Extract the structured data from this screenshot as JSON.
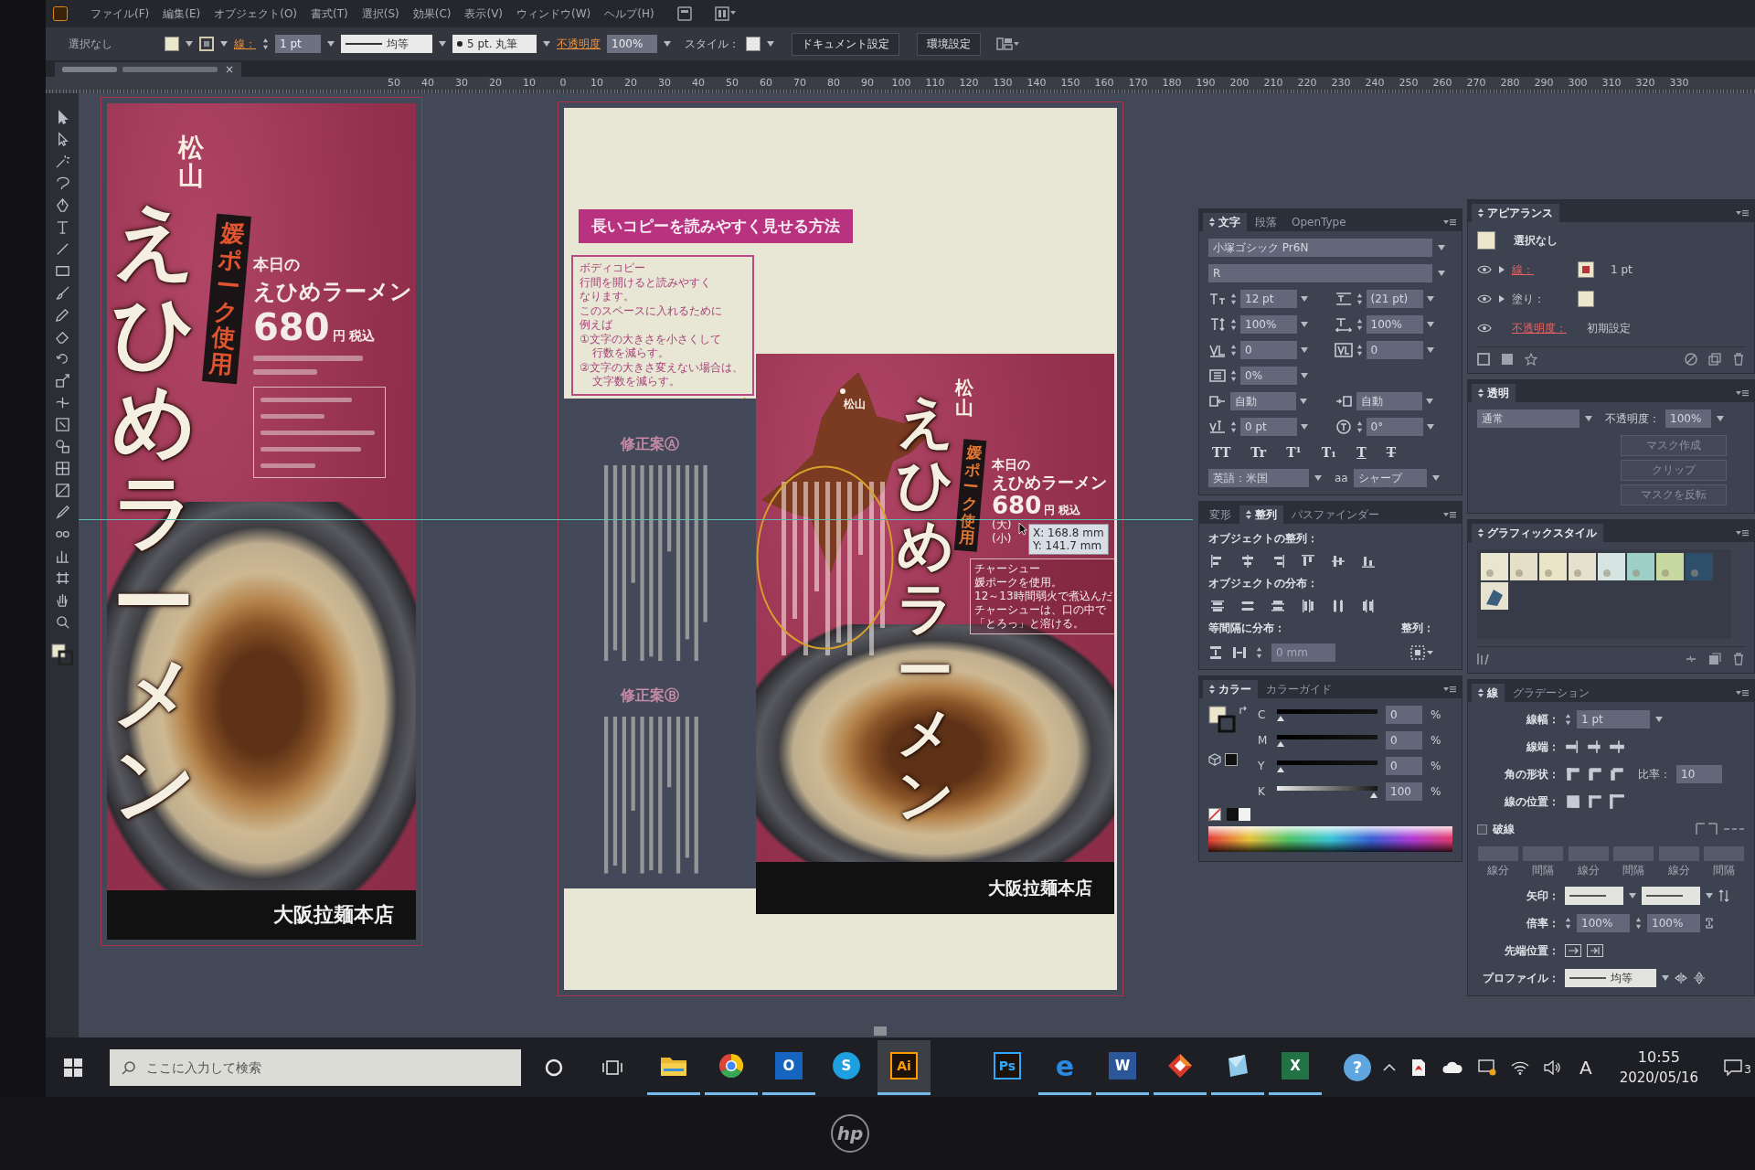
{
  "menu_bar": {
    "items": [
      "ファイル(F)",
      "編集(E)",
      "オブジェクト(O)",
      "書式(T)",
      "選択(S)",
      "効果(C)",
      "表示(V)",
      "ウィンドウ(W)",
      "ヘルプ(H)"
    ]
  },
  "control_bar": {
    "selection": "選択なし",
    "stroke_label": "線：",
    "stroke_weight": "1 pt",
    "profile": "均等",
    "brush": "5 pt. 丸筆",
    "opacity_label": "不透明度",
    "opacity": "100%",
    "style_label": "スタイル：",
    "buttons": [
      "ドキュメント設定",
      "環境設定"
    ]
  },
  "document_tab": {
    "close_glyph": "×"
  },
  "ruler": {
    "negative": [
      "50",
      "40",
      "30",
      "20",
      "10"
    ],
    "origin": "0",
    "positive": [
      "10",
      "20",
      "30",
      "40",
      "50",
      "60",
      "70",
      "80",
      "90",
      "100",
      "110",
      "120",
      "130",
      "140",
      "150",
      "160",
      "170",
      "180",
      "190",
      "200",
      "210",
      "220",
      "230",
      "240",
      "250",
      "260",
      "270",
      "280",
      "290",
      "300",
      "310",
      "320",
      "330"
    ]
  },
  "left_artboard": {
    "city": "松山",
    "title": "えひめラーメン",
    "ribbon": "媛ポーク使用",
    "today": "本日の",
    "dish": "えひめラーメン",
    "price": "680",
    "price_unit": "円 税込",
    "shop": "大阪拉麺本店"
  },
  "center_artboard": {
    "heading": "長いコピーを読みやすく見せる方法",
    "body_copy": [
      {
        "text": "ボディコピー",
        "indent": false
      },
      {
        "text": "行間を開けると読みやすく",
        "indent": false
      },
      {
        "text": "なります。",
        "indent": false
      },
      {
        "text": "このスペースに入れるために",
        "indent": false
      },
      {
        "text": "例えば",
        "indent": false
      },
      {
        "text": "①文字の大きさを小さくして",
        "indent": false
      },
      {
        "text": "行数を減らす。",
        "indent": true
      },
      {
        "text": "②文字の大きさ変えない場合は、",
        "indent": false
      },
      {
        "text": "文字数を減らす。",
        "indent": true
      }
    ],
    "proposals": [
      "修正案Ⓐ",
      "修正案Ⓑ"
    ],
    "poster": {
      "map_label": "松山",
      "city": "松山",
      "title": "えひめラーメン",
      "ribbon": "媛ポーク使用",
      "today": "本日の",
      "dish": "えひめラーメン",
      "price": "680",
      "price_unit": "円 税込",
      "sizes": [
        "(大)",
        "(小)"
      ],
      "note": [
        "チャーシュー",
        "媛ポークを使用。",
        "12～13時間弱火で煮込んだ",
        "チャーシューは、口の中で",
        "「とろっ」と溶ける。"
      ],
      "shop": "大阪拉麺本店"
    },
    "tooltip": [
      "X: 168.8 mm",
      "Y: 141.7 mm"
    ]
  },
  "character_panel": {
    "tabs": [
      {
        "label": "文字",
        "selected": true
      },
      {
        "label": "段落",
        "selected": false
      },
      {
        "label": "OpenType",
        "selected": false
      }
    ],
    "font_family": "小塚ゴシック Pr6N",
    "font_style": "R",
    "rows": [
      {
        "cells": [
          {
            "kind": "size",
            "value": "12 pt"
          },
          {
            "kind": "leading",
            "value": "(21 pt)"
          }
        ]
      },
      {
        "cells": [
          {
            "kind": "vscale",
            "value": "100%"
          },
          {
            "kind": "hscale",
            "value": "100%"
          }
        ]
      },
      {
        "cells": [
          {
            "kind": "kerning",
            "value": "0"
          },
          {
            "kind": "tracking",
            "value": "0"
          }
        ]
      },
      {
        "cells": [
          {
            "kind": "tsume",
            "value": "0%"
          }
        ]
      },
      {
        "cells": [
          {
            "kind": "aki_before",
            "value": "自動"
          },
          {
            "kind": "aki_after",
            "value": "自動"
          }
        ]
      },
      {
        "cells": [
          {
            "kind": "baseline",
            "value": "0 pt"
          },
          {
            "kind": "rotation",
            "value": "0°"
          }
        ]
      }
    ],
    "style_buttons": [
      {
        "glyph": "TT",
        "kind": "plain"
      },
      {
        "glyph": "Tr",
        "kind": "plain"
      },
      {
        "glyph": "T¹",
        "kind": "plain"
      },
      {
        "glyph": "T₁",
        "kind": "plain"
      },
      {
        "glyph": "T",
        "kind": "underline"
      },
      {
        "glyph": "T",
        "kind": "strike"
      }
    ],
    "language": "英語：米国",
    "antialias_glyph": "aa",
    "antialias": "シャープ"
  },
  "align_panel": {
    "tabs": [
      {
        "label": "変形",
        "selected": false
      },
      {
        "label": "整列",
        "selected": true
      },
      {
        "label": "パスファインダー",
        "selected": false
      }
    ],
    "align_label": "オブジェクトの整列：",
    "distribute_label": "オブジェクトの分布：",
    "spacing_label": "等間隔に分布：",
    "spacing_value": "0 mm",
    "align_to_label": "整列："
  },
  "color_panel": {
    "tabs": [
      {
        "label": "カラー",
        "selected": true
      },
      {
        "label": "カラーガイド",
        "selected": false
      }
    ],
    "channels": [
      {
        "name": "C",
        "level": 0,
        "value": "0",
        "unit": "%"
      },
      {
        "name": "M",
        "level": 0,
        "value": "0",
        "unit": "%"
      },
      {
        "name": "Y",
        "level": 0,
        "value": "0",
        "unit": "%"
      },
      {
        "name": "K",
        "level": 1,
        "value": "100",
        "unit": "%"
      }
    ]
  },
  "appearance_panel": {
    "tabs": [
      {
        "label": "アピアランス",
        "selected": true
      }
    ],
    "summary": "選択なし",
    "rows": [
      {
        "kind": "stroke",
        "label": "線：",
        "link": true,
        "value": "1 pt"
      },
      {
        "kind": "fill",
        "label": "塗り：",
        "link": false
      },
      {
        "kind": "opacity",
        "label": "不透明度：",
        "link": true,
        "value": "初期設定"
      }
    ]
  },
  "transparency_panel": {
    "tabs": [
      {
        "label": "透明",
        "selected": true
      }
    ],
    "mode": "通常",
    "opacity_label": "不透明度：",
    "opacity": "100%",
    "buttons": [
      {
        "label": "マスク作成",
        "disabled": true
      },
      {
        "label": "クリップ",
        "disabled": true
      },
      {
        "label": "マスクを反転",
        "disabled": true
      }
    ]
  },
  "graphic_styles_panel": {
    "tabs": [
      {
        "label": "グラフィックスタイル",
        "selected": true
      }
    ]
  },
  "stroke_panel": {
    "tabs": [
      {
        "label": "線",
        "selected": true
      },
      {
        "label": "グラデーション",
        "selected": false
      }
    ],
    "weight_label": "線幅：",
    "weight": "1 pt",
    "cap_label": "線端：",
    "corner_label": "角の形状：",
    "limit_label": "比率：",
    "limit": "10",
    "align_label": "線の位置：",
    "dashed": {
      "label": "破線",
      "checked": false
    },
    "dash_fields": [
      "線分",
      "間隔",
      "線分",
      "間隔",
      "線分",
      "間隔"
    ],
    "arrow_label": "矢印：",
    "scale_label": "倍率：",
    "scales": [
      "100%",
      "100%"
    ],
    "tip_label": "先端位置：",
    "profile_label": "プロファイル：",
    "profile": "均等"
  },
  "taskbar": {
    "search_placeholder": "ここに入力して検索",
    "apps": [
      {
        "kind": "folder",
        "running": true,
        "selected": false
      },
      {
        "kind": "browser",
        "running": true,
        "selected": false
      },
      {
        "kind": "filled",
        "glyph": "O",
        "color": "#1565c0",
        "running": true,
        "selected": false
      },
      {
        "kind": "round",
        "glyph": "S",
        "color": "#1e9fe0",
        "running": false,
        "selected": false
      },
      {
        "kind": "outlined",
        "glyph": "Ai",
        "color": "#ff9a00",
        "running": true,
        "selected": true
      },
      {
        "kind": "outlined",
        "glyph": "Ps",
        "color": "#31a8ff",
        "running": false,
        "selected": false
      },
      {
        "kind": "letter",
        "glyph": "e",
        "color": "#2b8ae0",
        "running": true,
        "selected": false
      },
      {
        "kind": "filled",
        "glyph": "W",
        "color": "#2b579a",
        "running": true,
        "selected": false
      },
      {
        "kind": "diamond",
        "running": true,
        "selected": false
      },
      {
        "kind": "pane",
        "running": true,
        "selected": false
      },
      {
        "kind": "filled",
        "glyph": "X",
        "color": "#217346",
        "running": true,
        "selected": false
      }
    ],
    "help_glyph": "?",
    "ime": "A",
    "time": "10:55",
    "date": "2020/05/16",
    "notifications": "3"
  },
  "bezel": {
    "logo": "hp"
  }
}
